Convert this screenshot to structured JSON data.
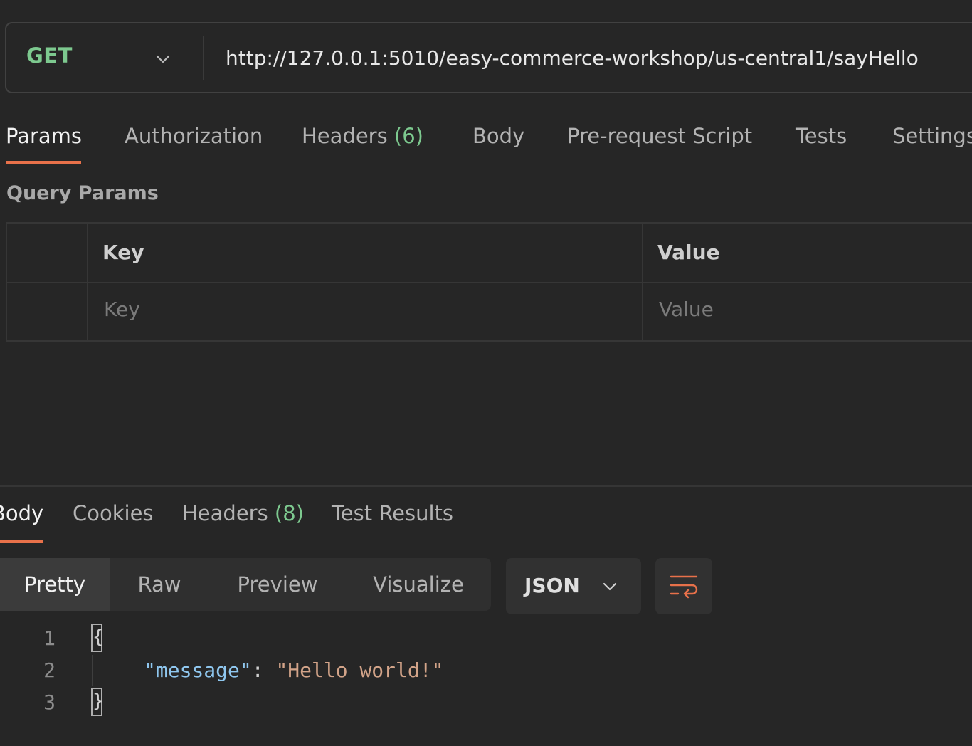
{
  "request": {
    "method": "GET",
    "url": "http://127.0.0.1:5010/easy-commerce-workshop/us-central1/sayHello"
  },
  "request_tabs": {
    "params": "Params",
    "authorization": "Authorization",
    "headers": "Headers",
    "headers_count": "(6)",
    "body": "Body",
    "pre_request": "Pre-request Script",
    "tests": "Tests",
    "settings": "Settings"
  },
  "query_params": {
    "title": "Query Params",
    "columns": {
      "key": "Key",
      "value": "Value"
    },
    "placeholders": {
      "key": "Key",
      "value": "Value"
    }
  },
  "response_tabs": {
    "body": "Body",
    "cookies": "Cookies",
    "headers": "Headers",
    "headers_count": "(8)",
    "test_results": "Test Results"
  },
  "view_modes": {
    "pretty": "Pretty",
    "raw": "Raw",
    "preview": "Preview",
    "visualize": "Visualize",
    "active": "Pretty"
  },
  "format": {
    "selected": "JSON"
  },
  "response_body": {
    "line_numbers": [
      "1",
      "2",
      "3"
    ],
    "open_brace": "{",
    "close_brace": "}",
    "key": "\"message\"",
    "colon": ": ",
    "value": "\"Hello world!\""
  },
  "colors": {
    "accent": "#e8714a",
    "method_green": "#7dc98f",
    "json_key": "#8fc7ef",
    "json_string": "#d3a489",
    "background": "#262626"
  },
  "icons": {
    "method_dropdown": "chevron-down-icon",
    "format_dropdown": "chevron-down-icon",
    "wrap": "wrap-lines-icon"
  }
}
